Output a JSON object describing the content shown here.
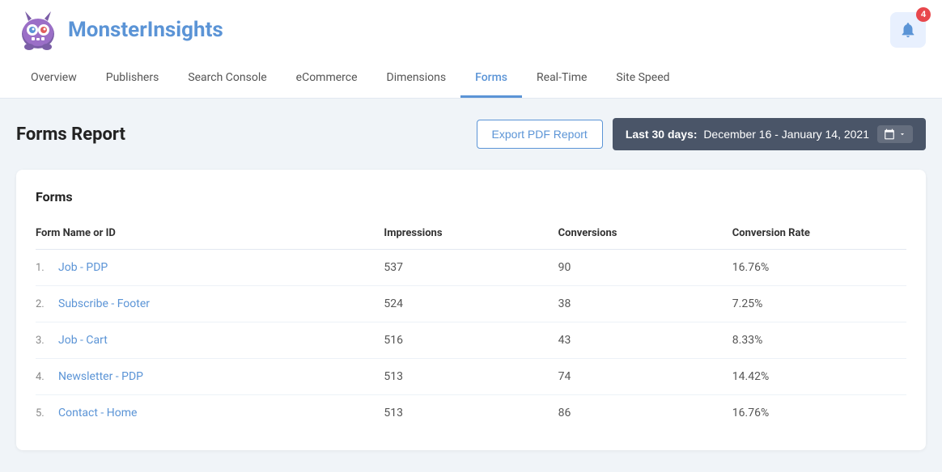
{
  "header": {
    "logo_main": "Monster",
    "logo_accent": "Insights",
    "notification_count": "4"
  },
  "nav": {
    "items": [
      {
        "label": "Overview",
        "active": false
      },
      {
        "label": "Publishers",
        "active": false
      },
      {
        "label": "Search Console",
        "active": false
      },
      {
        "label": "eCommerce",
        "active": false
      },
      {
        "label": "Dimensions",
        "active": false
      },
      {
        "label": "Forms",
        "active": true
      },
      {
        "label": "Real-Time",
        "active": false
      },
      {
        "label": "Site Speed",
        "active": false
      }
    ]
  },
  "main": {
    "page_title": "Forms Report",
    "export_btn": "Export PDF Report",
    "date_range_label": "Last 30 days:",
    "date_range_value": "December 16 - January 14, 2021"
  },
  "table": {
    "section_title": "Forms",
    "columns": [
      "Form Name or ID",
      "Impressions",
      "Conversions",
      "Conversion Rate"
    ],
    "rows": [
      {
        "num": "1.",
        "name": "Job - PDP",
        "impressions": "537",
        "conversions": "90",
        "conversion_rate": "16.76%"
      },
      {
        "num": "2.",
        "name": "Subscribe - Footer",
        "impressions": "524",
        "conversions": "38",
        "conversion_rate": "7.25%"
      },
      {
        "num": "3.",
        "name": "Job - Cart",
        "impressions": "516",
        "conversions": "43",
        "conversion_rate": "8.33%"
      },
      {
        "num": "4.",
        "name": "Newsletter - PDP",
        "impressions": "513",
        "conversions": "74",
        "conversion_rate": "14.42%"
      },
      {
        "num": "5.",
        "name": "Contact - Home",
        "impressions": "513",
        "conversions": "86",
        "conversion_rate": "16.76%"
      }
    ]
  }
}
